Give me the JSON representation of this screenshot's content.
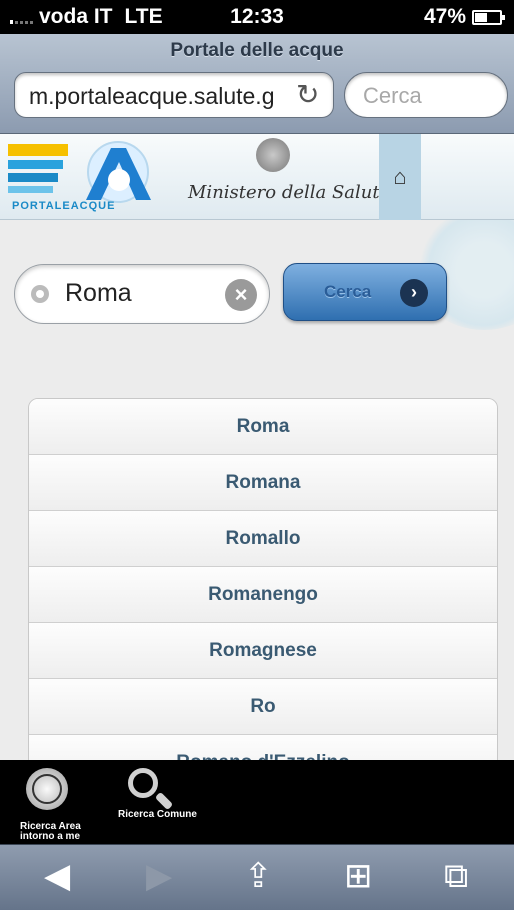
{
  "status_bar": {
    "carrier": "voda IT",
    "network": "LTE",
    "time": "12:33",
    "battery": "47%"
  },
  "browser": {
    "title": "Portale delle acque",
    "url": "m.portaleacque.salute.g",
    "search_placeholder": "Cerca"
  },
  "header": {
    "logo_text": "PORTALEACQUE",
    "ministry": "Ministero della Salute"
  },
  "search": {
    "value": "Roma",
    "button_label": "Cerca"
  },
  "results": [
    "Roma",
    "Romana",
    "Romallo",
    "Romanengo",
    "Romagnese",
    "Ro",
    "Romano d'Ezzelino"
  ],
  "toolbar": {
    "area_label": "Ricerca Area intorno a me",
    "comune_label": "Ricerca Comune"
  },
  "colors": {
    "accent": "#2f6fb0",
    "list_text": "#3a5a72"
  }
}
